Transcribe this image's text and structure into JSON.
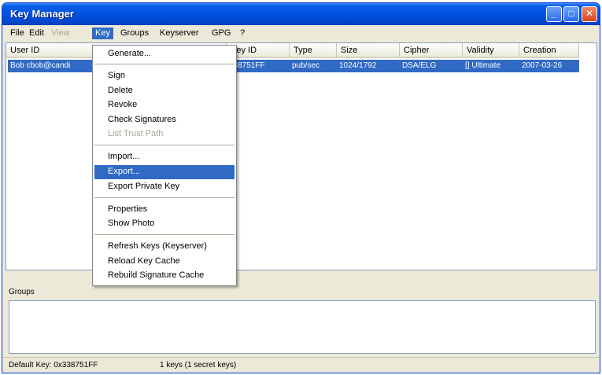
{
  "window": {
    "title": "Key Manager"
  },
  "menubar": {
    "items": [
      {
        "label": "File"
      },
      {
        "label": "Edit"
      },
      {
        "label": "View"
      },
      {
        "label": "Key"
      },
      {
        "label": "Groups"
      },
      {
        "label": "Keyserver"
      },
      {
        "label": "GPG"
      },
      {
        "label": "?"
      }
    ]
  },
  "list": {
    "columns": [
      "User ID",
      "Key ID",
      "Type",
      "Size",
      "Cipher",
      "Validity",
      "Creation"
    ],
    "row": {
      "user_id": "Bob cbob@candi",
      "key_id": "338751FF",
      "type": "pub/sec",
      "size": "1024/1792",
      "cipher": "DSA/ELG",
      "validity": "[] Ultimate",
      "creation": "2007-03-26"
    }
  },
  "key_menu": {
    "items": [
      {
        "label": "Generate...",
        "state": "normal"
      },
      {
        "label": "Sign",
        "state": "normal"
      },
      {
        "label": "Delete",
        "state": "normal"
      },
      {
        "label": "Revoke",
        "state": "normal"
      },
      {
        "label": "Check Signatures",
        "state": "normal"
      },
      {
        "label": "List Trust Path",
        "state": "disabled"
      },
      {
        "label": "Import...",
        "state": "normal"
      },
      {
        "label": "Export...",
        "state": "highlighted"
      },
      {
        "label": "Export Private Key",
        "state": "normal"
      },
      {
        "label": "Properties",
        "state": "normal"
      },
      {
        "label": "Show Photo",
        "state": "normal"
      },
      {
        "label": "Refresh Keys (Keyserver)",
        "state": "normal"
      },
      {
        "label": "Reload Key Cache",
        "state": "normal"
      },
      {
        "label": "Rebuild Signature Cache",
        "state": "normal"
      }
    ]
  },
  "groups": {
    "label": "Groups"
  },
  "statusbar": {
    "default_key": "Default Key: 0x338751FF",
    "key_count": "1 keys (1 secret keys)"
  },
  "colors": {
    "selection": "#316ac5",
    "title_bar": "#0054e3",
    "window_bg": "#ece9d8"
  }
}
